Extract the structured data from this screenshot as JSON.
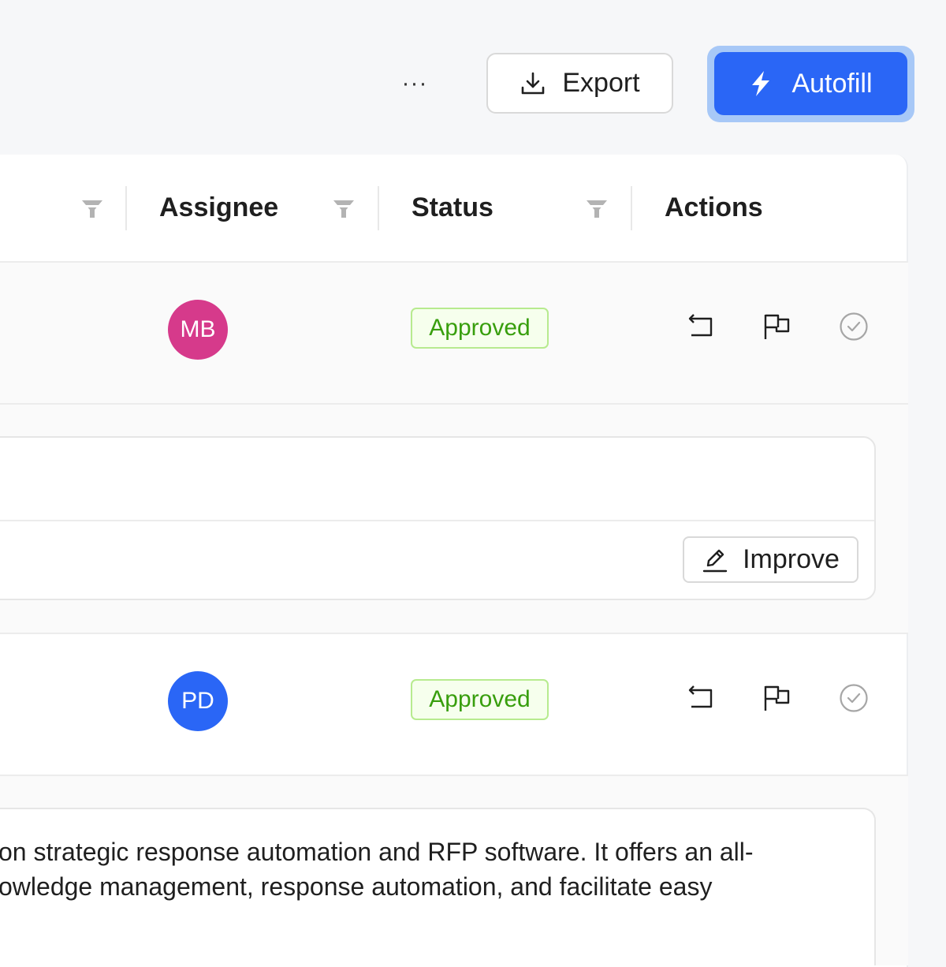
{
  "toolbar": {
    "more_label": "···",
    "export_label": "Export",
    "autofill_label": "Autofill",
    "icons": {
      "export": "download-icon",
      "autofill": "lightning-icon",
      "more": "ellipsis-icon"
    },
    "colors": {
      "primary": "#2a66f6"
    }
  },
  "table": {
    "columns": [
      {
        "label": "Assignee",
        "filter_icon": "filter-icon"
      },
      {
        "label": "Status",
        "filter_icon": "filter-icon"
      },
      {
        "label": "Actions"
      }
    ],
    "rows": [
      {
        "assignee_initials": "MB",
        "avatar_color": "#d63a8b",
        "status": "Approved",
        "actions": [
          "undo-icon",
          "flag-icon",
          "check-circle-icon"
        ]
      },
      {
        "assignee_initials": "PD",
        "avatar_color": "#2a66f6",
        "status": "Approved",
        "actions": [
          "undo-icon",
          "flag-icon",
          "check-circle-icon"
        ]
      }
    ],
    "status_colors": {
      "approved_text": "#389e0d",
      "approved_bg": "#f6ffed",
      "approved_border": "#b7eb8f"
    }
  },
  "answer_panel": {
    "improve_label": "Improve",
    "improve_icon": "edit-icon"
  },
  "answer_text": {
    "line1": "on strategic response automation and RFP software. It offers an all-",
    "line2": "owledge management, response automation, and facilitate easy"
  }
}
